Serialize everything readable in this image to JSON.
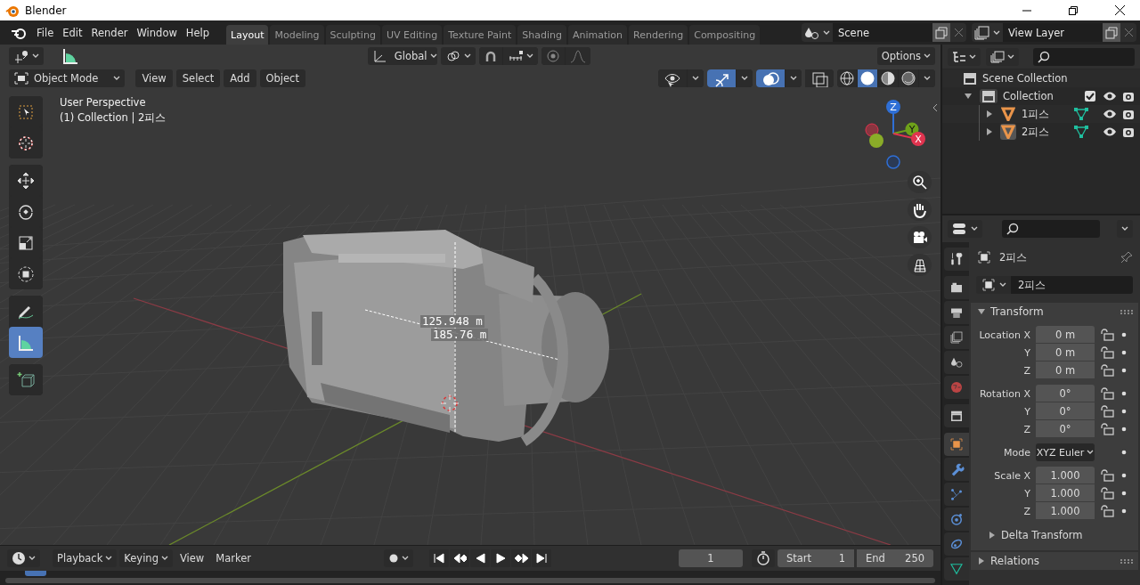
{
  "window": {
    "title": "Blender"
  },
  "menu": [
    "File",
    "Edit",
    "Render",
    "Window",
    "Help"
  ],
  "workspaces": [
    {
      "label": "Layout",
      "selected": true
    },
    {
      "label": "Modeling",
      "selected": false
    },
    {
      "label": "Sculpting",
      "selected": false
    },
    {
      "label": "UV Editing",
      "selected": false
    },
    {
      "label": "Texture Paint",
      "selected": false
    },
    {
      "label": "Shading",
      "selected": false
    },
    {
      "label": "Animation",
      "selected": false
    },
    {
      "label": "Rendering",
      "selected": false
    },
    {
      "label": "Compositing",
      "selected": false
    }
  ],
  "scene": {
    "name": "Scene"
  },
  "view_layer": {
    "name": "View Layer"
  },
  "viewport": {
    "orientation": "Global",
    "options": "Options",
    "mode": "Object Mode",
    "menus": [
      "View",
      "Select",
      "Add",
      "Object"
    ],
    "toggles": [
      {
        "kind": "visibility",
        "on": false
      },
      {
        "kind": "gizmo",
        "on": true
      },
      {
        "kind": "overlay",
        "on": true
      },
      {
        "kind": "xray",
        "on": false
      }
    ],
    "shading": [
      {
        "kind": "wireframe",
        "selected": false
      },
      {
        "kind": "solid",
        "selected": true
      },
      {
        "kind": "material",
        "selected": false
      },
      {
        "kind": "rendered",
        "selected": false
      }
    ],
    "toolbar": [
      [
        {
          "kind": "select-box",
          "selected": false
        },
        {
          "kind": "cursor",
          "selected": false
        }
      ],
      [
        {
          "kind": "move",
          "selected": false
        },
        {
          "kind": "rotate",
          "selected": false
        },
        {
          "kind": "scale",
          "selected": false
        },
        {
          "kind": "transform",
          "selected": false
        }
      ],
      [
        {
          "kind": "annotate",
          "selected": false
        },
        {
          "kind": "measure",
          "selected": true
        }
      ],
      [
        {
          "kind": "add-cube",
          "selected": false
        }
      ]
    ],
    "info": [
      "User Perspective",
      "(1) Collection | 2피스"
    ],
    "measurements": [
      "125.948 m",
      "185.76 m"
    ],
    "gizmo_axes": [
      "Z",
      "Y",
      "X"
    ]
  },
  "outliner": {
    "root": "Scene Collection",
    "items": [
      {
        "label": "Collection",
        "expanded": true,
        "checked": true,
        "children": [
          {
            "label": "1피스",
            "active": false
          },
          {
            "label": "2피스",
            "active": true
          }
        ]
      }
    ]
  },
  "properties": {
    "tabs": [
      [
        {
          "kind": "tool",
          "selected": false
        }
      ],
      [
        {
          "kind": "render",
          "selected": false
        },
        {
          "kind": "output",
          "selected": false
        },
        {
          "kind": "view-layer",
          "selected": false
        },
        {
          "kind": "scene",
          "selected": false
        },
        {
          "kind": "world",
          "selected": false
        }
      ],
      [
        {
          "kind": "collection",
          "selected": false
        }
      ],
      [
        {
          "kind": "object",
          "selected": true
        },
        {
          "kind": "modifiers",
          "selected": false
        },
        {
          "kind": "particles",
          "selected": false
        },
        {
          "kind": "physics",
          "selected": false
        },
        {
          "kind": "constraints",
          "selected": false
        },
        {
          "kind": "data",
          "selected": false
        }
      ]
    ],
    "object_name": "2피스",
    "name_field": "2피스",
    "panels": [
      {
        "title": "Transform",
        "expanded": true,
        "groups": [
          [
            {
              "kind": "number",
              "label": "Location X",
              "value": "0 m"
            },
            {
              "kind": "number",
              "label": "Y",
              "value": "0 m"
            },
            {
              "kind": "number",
              "label": "Z",
              "value": "0 m"
            }
          ],
          [
            {
              "kind": "number",
              "label": "Rotation X",
              "value": "0°"
            },
            {
              "kind": "number",
              "label": "Y",
              "value": "0°"
            },
            {
              "kind": "number",
              "label": "Z",
              "value": "0°"
            }
          ],
          [
            {
              "kind": "dropdown",
              "label": "Mode",
              "value": "XYZ Euler"
            }
          ],
          [
            {
              "kind": "number",
              "label": "Scale X",
              "value": "1.000"
            },
            {
              "kind": "number",
              "label": "Y",
              "value": "1.000"
            },
            {
              "kind": "number",
              "label": "Z",
              "value": "1.000"
            }
          ]
        ],
        "subpanels": [
          {
            "title": "Delta Transform",
            "expanded": false
          }
        ]
      },
      {
        "title": "Relations",
        "expanded": false
      }
    ]
  },
  "timeline": {
    "menus": [
      {
        "label": "Playback",
        "kind": "dropdown"
      },
      {
        "label": "Keying",
        "kind": "dropdown"
      },
      {
        "label": "View",
        "kind": "menu"
      },
      {
        "label": "Marker",
        "kind": "menu"
      }
    ],
    "current_frame": "1",
    "start_label": "Start",
    "start": "1",
    "end_label": "End",
    "end": "250"
  }
}
